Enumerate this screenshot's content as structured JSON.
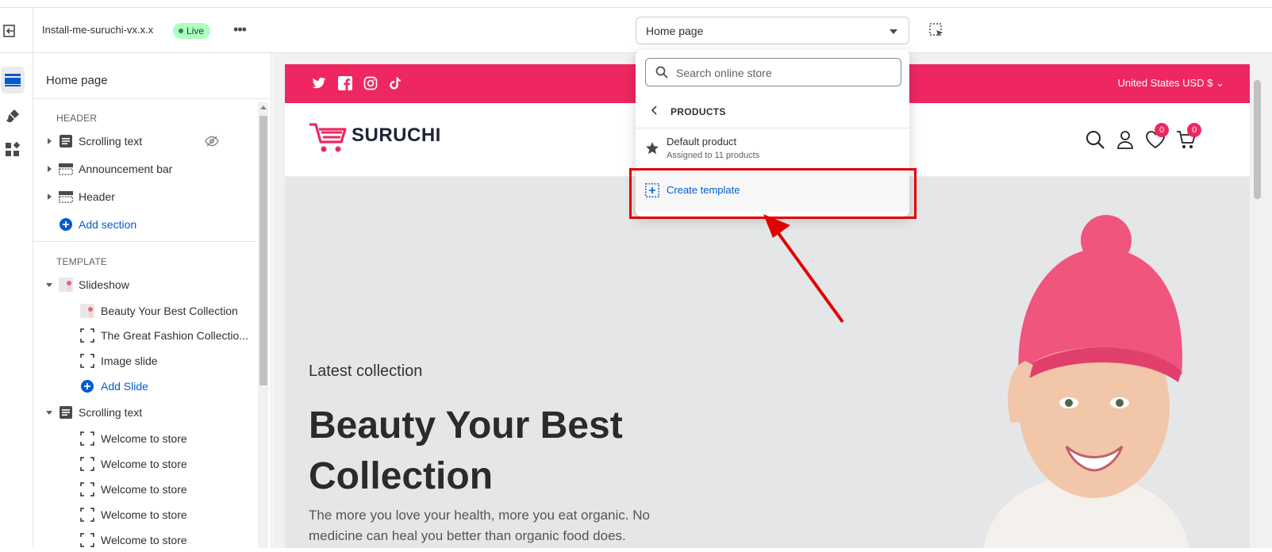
{
  "topbar": {
    "theme_name": "Install-me-suruchi-vx.x.x",
    "status_badge": "Live",
    "more_label": "•••",
    "page_selector": "Home page"
  },
  "sidebar": {
    "title": "Home page",
    "header_section_label": "HEADER",
    "header_items": [
      {
        "label": "Scrolling text",
        "icon": "text-block-icon"
      },
      {
        "label": "Announcement bar",
        "icon": "section-icon"
      },
      {
        "label": "Header",
        "icon": "section-icon"
      }
    ],
    "add_section": "Add section",
    "template_section_label": "TEMPLATE",
    "slideshow": {
      "label": "Slideshow",
      "blocks": [
        "Beauty Your Best Collection",
        "The Great Fashion Collectio...",
        "Image slide"
      ],
      "add_slide": "Add Slide"
    },
    "scrolling_text": {
      "label": "Scrolling text",
      "blocks": [
        "Welcome to store",
        "Welcome to store",
        "Welcome to store",
        "Welcome to store",
        "Welcome to store"
      ]
    }
  },
  "dropdown": {
    "search_placeholder": "Search online store",
    "section_title": "PRODUCTS",
    "item_title": "Default product",
    "item_subtitle": "Assigned to 11 products",
    "create_label": "Create template"
  },
  "store": {
    "currency": "United States USD $",
    "logo_text": "SURUCHI",
    "wishlist_count": "0",
    "cart_count": "0",
    "hero_kicker": "Latest collection",
    "hero_title": "Beauty Your Best Collection",
    "hero_description": "The more you love your health, more you eat organic. No medicine can heal you better than organic food does."
  },
  "colors": {
    "brand_pink": "#ee2761",
    "annotation_red": "#e00000",
    "link_blue": "#005bd3",
    "live_badge_bg": "#affebf"
  }
}
